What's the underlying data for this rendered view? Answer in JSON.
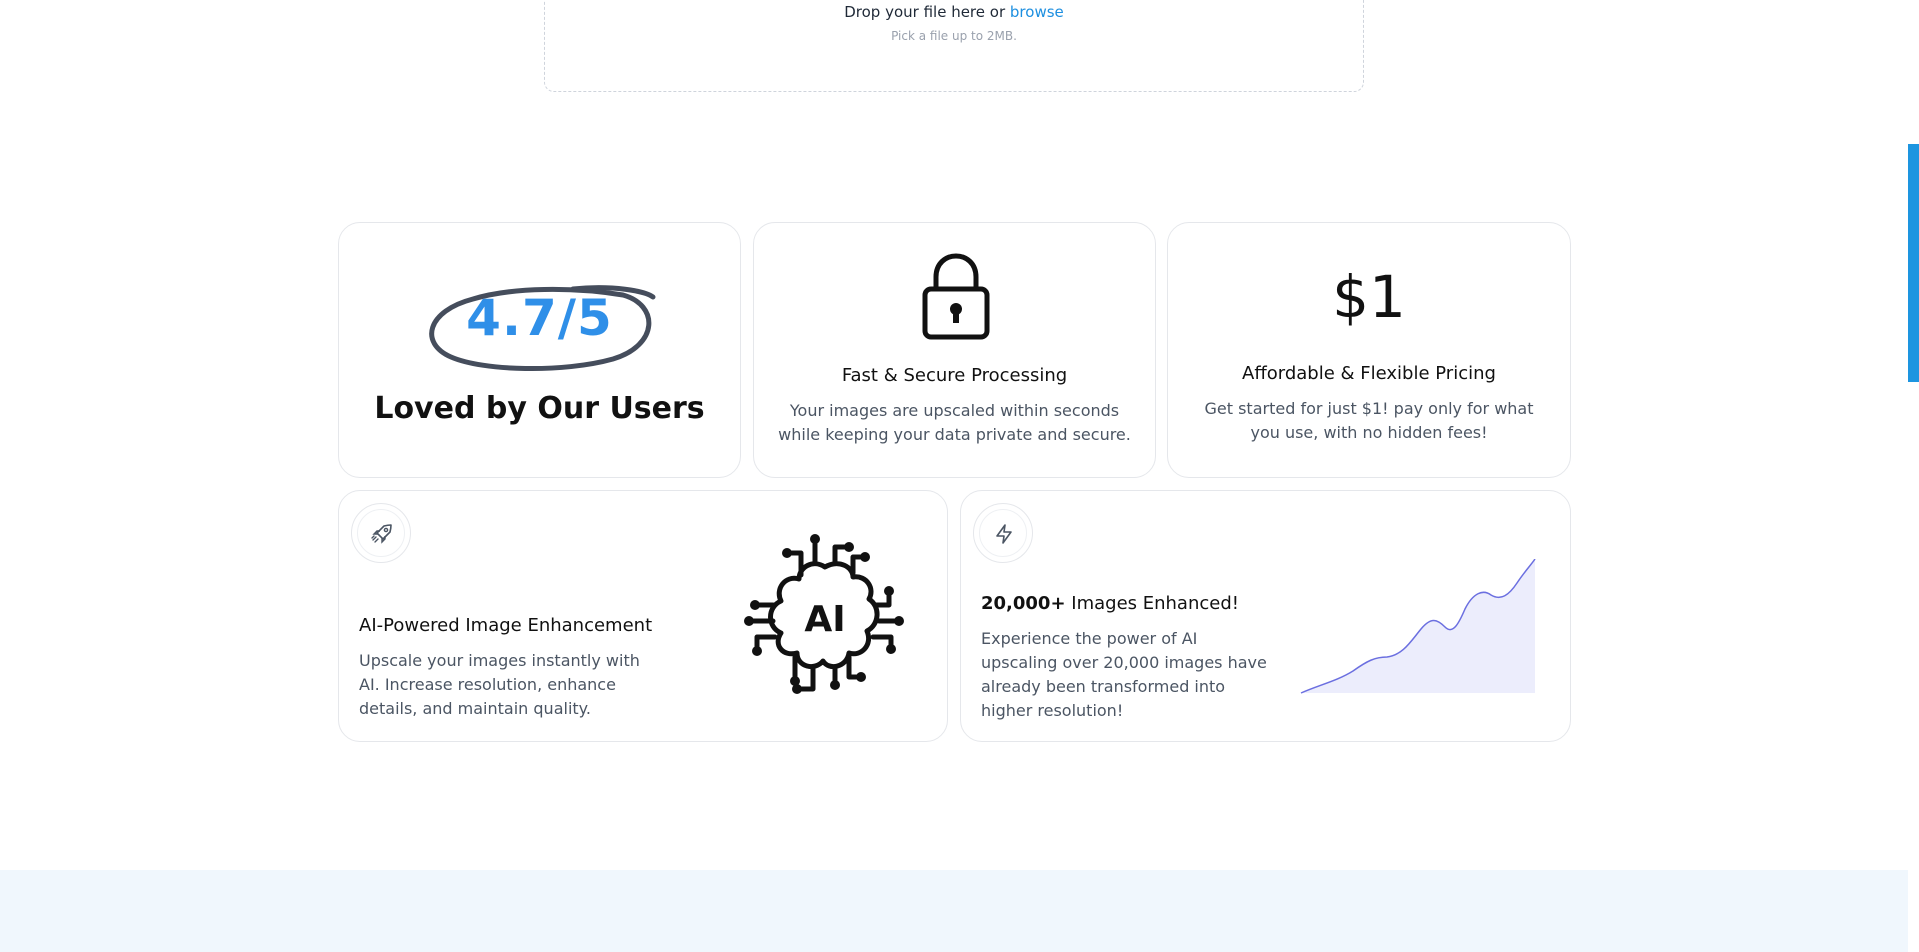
{
  "upload": {
    "drop_text": "Drop your file here or",
    "browse_label": "browse",
    "hint": "Pick a file up to 2MB."
  },
  "rating_card": {
    "rating": "4.7/5",
    "title": "Loved by Our Users"
  },
  "secure_card": {
    "icon": "lock-icon",
    "title": "Fast & Secure Processing",
    "description": "Your images are upscaled within seconds while keeping your data private and secure."
  },
  "pricing_card": {
    "price": "$1",
    "title": "Affordable & Flexible Pricing",
    "description": "Get started for just $1! pay only for what you use, with no hidden fees!"
  },
  "ai_card": {
    "icon": "rocket-icon",
    "title": "AI-Powered Image Enhancement",
    "description": "Upscale your images instantly with AI. Increase resolution, enhance details, and maintain quality.",
    "illustration_label": "AI"
  },
  "growth_card": {
    "icon": "bolt-icon",
    "title_strong": "20,000+",
    "title_rest": " Images Enhanced!",
    "description": "Experience the power of AI upscaling over 20,000 images have already been transformed into higher resolution!"
  },
  "colors": {
    "accent": "#2f8fe8",
    "link": "#1d8fe0",
    "chart_line": "#6b6fe0",
    "chart_fill": "#ecedfc",
    "band": "#f0f7fd"
  }
}
